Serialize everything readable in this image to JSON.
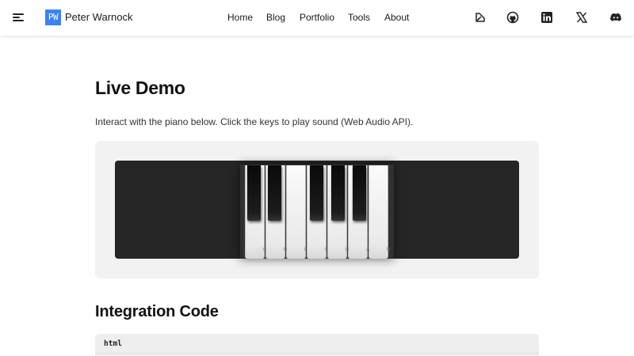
{
  "header": {
    "logo_text": "PW",
    "site_name": "Peter Warnock",
    "nav": [
      {
        "label": "Home"
      },
      {
        "label": "Blog"
      },
      {
        "label": "Portfolio"
      },
      {
        "label": "Tools"
      },
      {
        "label": "About"
      }
    ],
    "social_icons": [
      "design-tool-icon",
      "github-icon",
      "linkedin-icon",
      "x-icon",
      "discord-icon"
    ]
  },
  "main": {
    "title": "Live Demo",
    "description": "Interact with the piano below. Click the keys to play sound (Web Audio API).",
    "piano": {
      "white_keys": [
        "C",
        "D",
        "E",
        "F",
        "G",
        "A",
        "B"
      ],
      "black_keys": [
        "C#",
        "D#",
        "F#",
        "G#",
        "A#"
      ]
    },
    "section_title": "Integration Code",
    "code_language": "html"
  },
  "colors": {
    "brand": "#3b82f6",
    "demo_background": "#f2f2f2",
    "stage_background": "#262626"
  }
}
